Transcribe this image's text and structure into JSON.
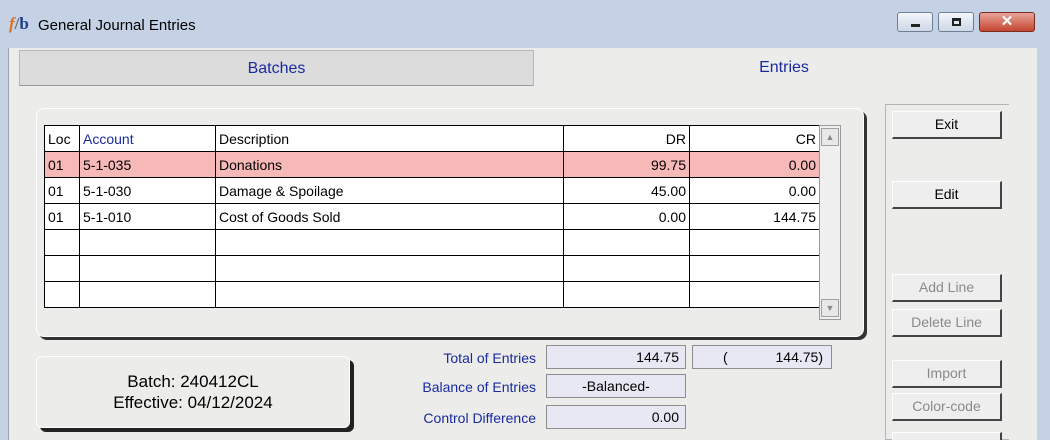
{
  "window": {
    "logo": {
      "f": "f",
      "slash": "/",
      "b": "b"
    },
    "title": "General Journal Entries",
    "controls": {
      "minimize": "minimize",
      "maximize": "maximize",
      "close": "✕"
    }
  },
  "tabs": [
    {
      "label": "Batches",
      "active": false
    },
    {
      "label": "Entries",
      "active": true
    }
  ],
  "grid": {
    "columns": [
      "Loc",
      "Account",
      "Description",
      "DR",
      "CR"
    ],
    "rows": [
      {
        "loc": "01",
        "account": "5-1-035",
        "description": "Donations",
        "dr": "99.75",
        "cr": "0.00",
        "selected": true
      },
      {
        "loc": "01",
        "account": "5-1-030",
        "description": "Damage & Spoilage",
        "dr": "45.00",
        "cr": "0.00",
        "selected": false
      },
      {
        "loc": "01",
        "account": "5-1-010",
        "description": "Cost of Goods Sold",
        "dr": "0.00",
        "cr": "144.75",
        "selected": false
      }
    ],
    "selected_row_color": "#f7b9b8"
  },
  "batch": {
    "batch_text": "Batch: 240412CL",
    "effective_text": "Effective: 04/12/2024"
  },
  "totals": {
    "total_label": "Total of Entries",
    "total_dr": "144.75",
    "total_cr_open": "(",
    "total_cr": "144.75)",
    "balance_label": "Balance of Entries",
    "balance_value": "-Balanced-",
    "control_label": "Control Difference",
    "control_value": "0.00"
  },
  "buttons": {
    "exit": "Exit",
    "edit": "Edit",
    "add_line": "Add Line",
    "delete_line": "Delete Line",
    "import": "Import",
    "color_code": "Color-code"
  }
}
